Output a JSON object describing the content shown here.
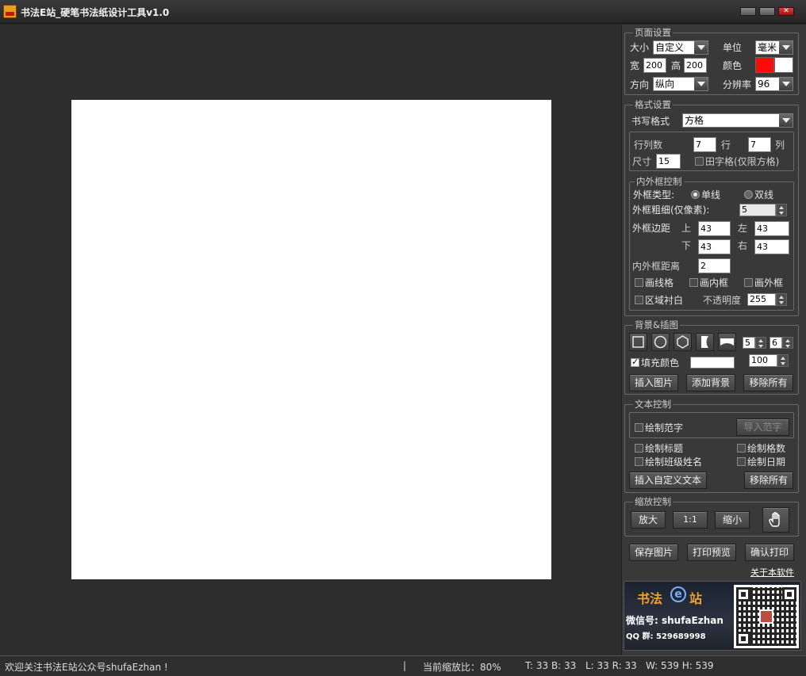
{
  "window": {
    "title": "书法E站_硬笔书法纸设计工具v1.0"
  },
  "page_settings": {
    "group_title": "页面设置",
    "size_label": "大小",
    "size_value": "自定义",
    "unit_label": "单位",
    "unit_value": "毫米",
    "width_label": "宽",
    "width_value": "200",
    "height_label": "高",
    "height_value": "200",
    "color_label": "颜色",
    "colors": {
      "primary": "#ff0a0a",
      "secondary": "#ffffff"
    },
    "orientation_label": "方向",
    "orientation_value": "纵向",
    "resolution_label": "分辨率",
    "resolution_value": "96"
  },
  "format_settings": {
    "group_title": "格式设置",
    "style_label": "书写格式",
    "style_value": "方格",
    "rows_cols_label": "行列数",
    "rows_value": "7",
    "rows_unit": "行",
    "cols_value": "7",
    "cols_unit": "列",
    "size_label": "尺寸",
    "size_value": "15",
    "tianzige_label": "田字格(仅限方格)"
  },
  "frame_control": {
    "group_title": "内外框控制",
    "outer_type_label": "外框类型:",
    "single_label": "单线",
    "double_label": "双线",
    "outer_width_label": "外框粗细(仅像素):",
    "outer_width_value": "5",
    "margin_label": "外框边距",
    "top_label": "上",
    "top_value": "43",
    "left_label": "左",
    "left_value": "43",
    "bottom_label": "下",
    "bottom_value": "43",
    "right_label": "右",
    "right_value": "43",
    "inner_outer_label": "内外框距离",
    "inner_outer_value": "2",
    "draw_grid_label": "画线格",
    "draw_inner_label": "画内框",
    "draw_outer_label": "画外框",
    "region_white_label": "区域衬白",
    "opacity_label": "不透明度",
    "opacity_value": "255"
  },
  "background": {
    "group_title": "背景&插图",
    "spin1_value": "5",
    "spin2_value": "6",
    "fill_color_label": "填充颜色",
    "fill_color": "#ffffff",
    "fill_opacity_value": "100",
    "insert_image_label": "插入图片",
    "add_bg_label": "添加背景",
    "remove_all_label": "移除所有"
  },
  "text_control": {
    "group_title": "文本控制",
    "draw_sample_label": "绘制范字",
    "import_sample_label": "导入范字",
    "draw_title_label": "绘制标题",
    "draw_grid_count_label": "绘制格数",
    "draw_class_name_label": "绘制班级姓名",
    "draw_date_label": "绘制日期",
    "insert_custom_label": "插入自定义文本",
    "remove_all_label": "移除所有"
  },
  "zoom_control": {
    "group_title": "缩放控制",
    "zoom_in_label": "放大",
    "actual_label": "1:1",
    "zoom_out_label": "缩小"
  },
  "actions": {
    "save_label": "保存图片",
    "preview_label": "打印预览",
    "print_label": "确认打印",
    "about_label": "关于本软件"
  },
  "banner": {
    "site_name_left": "书法",
    "site_e": "e",
    "site_name_right": "站",
    "wechat": "微信号: shufaEzhan",
    "qq": "QQ 群: 529689998"
  },
  "status": {
    "welcome": "欢迎关注书法E站公众号shufaEzhan !",
    "separator": "|",
    "zoom": "当前缩放比：80%",
    "tb": "T: 33 B: 33",
    "lr": "L: 33 R: 33",
    "wh": "W: 539 H: 539"
  }
}
